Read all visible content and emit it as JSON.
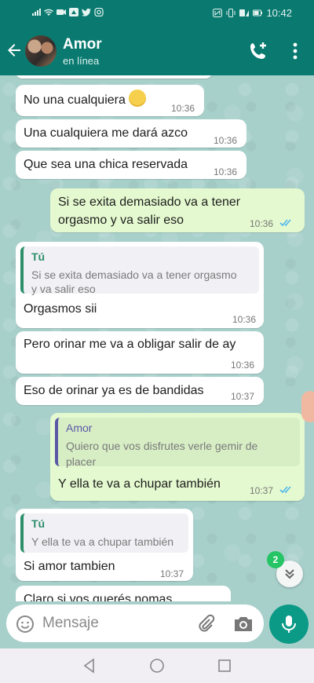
{
  "status_bar": {
    "time": "10:42"
  },
  "header": {
    "name": "Amor",
    "status": "en línea"
  },
  "messages": [
    {
      "text": "No una cualquiera",
      "time": "10:36"
    },
    {
      "text": "Una cualquiera me dará azco",
      "time": "10:36"
    },
    {
      "text": "Que sea una chica reservada",
      "time": "10:36"
    },
    {
      "text1": "Si se exita demasiado va a tener",
      "text2": "orgasmo y va salir eso",
      "time": "10:36"
    },
    {
      "quote_author": "Tú",
      "quote1": "Si se exita demasiado va a tener orgasmo",
      "quote2": "y va salir eso",
      "text": "Orgasmos sii",
      "time": "10:36"
    },
    {
      "text": "Pero orinar me va a obligar salir de ay",
      "time": "10:36"
    },
    {
      "text": "Eso de orinar ya es de bandidas",
      "time": "10:37"
    },
    {
      "quote_author": "Amor",
      "quote1": "Quiero que vos disfrutes verle gemir de",
      "quote2": "placer",
      "text": "Y ella te va a chupar también",
      "time": "10:37"
    },
    {
      "quote_author": "Tú",
      "quote1": "Y ella te va a chupar también",
      "text": "Si amor tambien",
      "time": "10:37"
    },
    {
      "text": "Claro si vos querés nomas"
    }
  ],
  "unread_badge": "2",
  "input": {
    "placeholder": "Mensaje"
  },
  "colors": {
    "header": "#0a7a70",
    "outgoing": "#e4f9cf",
    "incoming": "#ffffff",
    "accent": "#0a9a86"
  }
}
